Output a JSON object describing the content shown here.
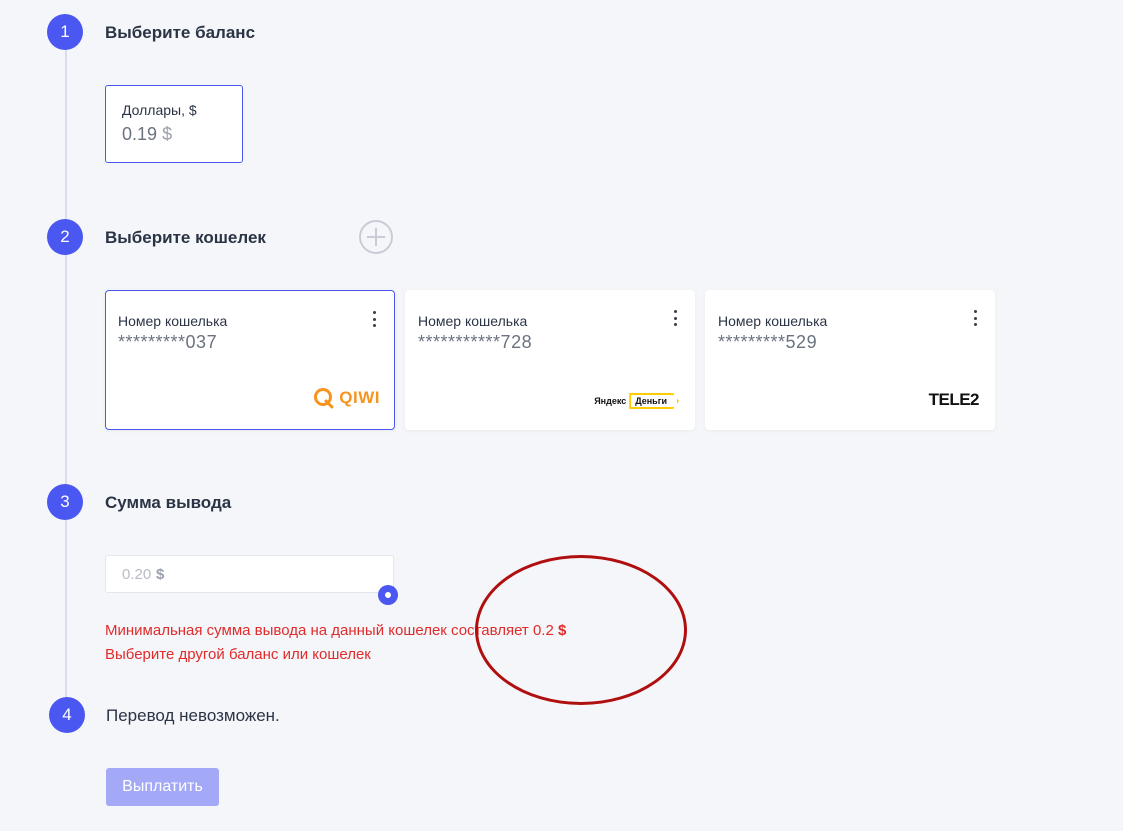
{
  "steps": [
    {
      "number": "1",
      "title": "Выберите баланс"
    },
    {
      "number": "2",
      "title": "Выберите кошелек"
    },
    {
      "number": "3",
      "title": "Сумма вывода"
    },
    {
      "number": "4",
      "title": ""
    }
  ],
  "balance": {
    "label": "Доллары, $",
    "value": "0.19",
    "currency": "$"
  },
  "wallets": [
    {
      "label": "Номер кошелька",
      "number": "*********037",
      "provider": "QIWI",
      "selected": true
    },
    {
      "label": "Номер кошелька",
      "number": "***********728",
      "provider": "Яндекс Деньги",
      "provider_parts": [
        "Яндекс",
        "Деньги"
      ],
      "selected": false
    },
    {
      "label": "Номер кошелька",
      "number": "*********529",
      "provider": "TELE2",
      "selected": false
    }
  ],
  "amount": {
    "value": "0.20",
    "currency": "$"
  },
  "errors": {
    "min_amount_text": "Минимальная сумма вывода на данный кошелек составляет 0.2",
    "min_amount_currency": "$",
    "choose_other": "Выберите другой баланс или кошелек"
  },
  "transfer_status": "Перевод невозможен.",
  "pay_button": "Выплатить",
  "icons": [
    "plus-icon",
    "more-vertical-icon",
    "qiwi-logo",
    "yandex-money-logo",
    "tele2-logo"
  ],
  "colors": {
    "accent": "#4a57f0",
    "error": "#e02b2b",
    "annotation": "#b00f0f",
    "button_disabled": "#a3a8f7"
  }
}
